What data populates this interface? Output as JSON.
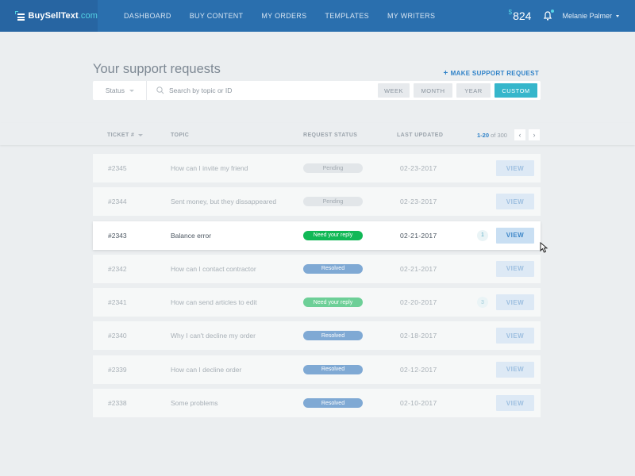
{
  "brand": {
    "name": "BuySellText",
    "tld": ".com"
  },
  "nav": [
    {
      "label": "DASHBOARD"
    },
    {
      "label": "BUY CONTENT"
    },
    {
      "label": "MY ORDERS"
    },
    {
      "label": "TEMPLATES"
    },
    {
      "label": "MY WRITERS"
    }
  ],
  "account": {
    "currency_symbol": "$",
    "balance": "824",
    "user_name": "Melanie Palmer",
    "has_notifications": true
  },
  "page": {
    "title": "Your support requests",
    "make_request_icon": "+",
    "make_request_label": "MAKE SUPPORT REQUEST"
  },
  "filters": {
    "status_label": "Status",
    "search_placeholder": "Search by topic or ID",
    "search_value": "",
    "ranges": [
      {
        "label": "WEEK",
        "active": false
      },
      {
        "label": "MONTH",
        "active": false
      },
      {
        "label": "YEAR",
        "active": false
      },
      {
        "label": "CUSTOM",
        "active": true
      }
    ]
  },
  "table": {
    "columns": {
      "ticket": "TICKET #",
      "topic": "TOPIC",
      "status": "REQUEST STATUS",
      "updated": "LAST UPDATED"
    },
    "pagination": {
      "range": "1-20",
      "of_label": "of",
      "total": "300",
      "prev": "‹",
      "next": "›"
    },
    "view_label": "VIEW",
    "rows": [
      {
        "id": "#2345",
        "topic": "How can I invite my friend",
        "status": "Pending",
        "status_type": "pending",
        "updated": "02-23-2017",
        "unread": ""
      },
      {
        "id": "#2344",
        "topic": "Sent money, but they dissappeared",
        "status": "Pending",
        "status_type": "pending",
        "updated": "02-23-2017",
        "unread": ""
      },
      {
        "id": "#2343",
        "topic": "Balance error",
        "status": "Need your reply",
        "status_type": "reply",
        "updated": "02-21-2017",
        "unread": "1",
        "highlighted": true
      },
      {
        "id": "#2342",
        "topic": "How can I contact contractor",
        "status": "Resolved",
        "status_type": "resolved",
        "updated": "02-21-2017",
        "unread": ""
      },
      {
        "id": "#2341",
        "topic": "How can send articles to edit",
        "status": "Need your reply",
        "status_type": "reply",
        "updated": "02-20-2017",
        "unread": "3"
      },
      {
        "id": "#2340",
        "topic": "Why I can't decline my order",
        "status": "Resolved",
        "status_type": "resolved",
        "updated": "02-18-2017",
        "unread": ""
      },
      {
        "id": "#2339",
        "topic": "How can I decline order",
        "status": "Resolved",
        "status_type": "resolved",
        "updated": "02-12-2017",
        "unread": ""
      },
      {
        "id": "#2338",
        "topic": "Some problems",
        "status": "Resolved",
        "status_type": "resolved",
        "updated": "02-10-2017",
        "unread": ""
      }
    ]
  },
  "colors": {
    "topbar": "#2a6fae",
    "accent": "#36b6cb",
    "link": "#2f82c8",
    "status_reply": "#11b856",
    "status_resolved": "#7fa9d4",
    "status_pending": "#e2e6e9"
  }
}
